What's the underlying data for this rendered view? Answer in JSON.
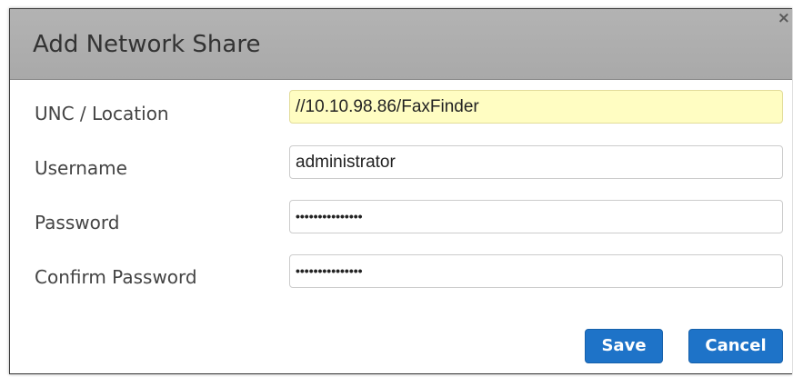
{
  "dialog": {
    "title": "Add Network Share",
    "close_label": "×"
  },
  "form": {
    "unc": {
      "label": "UNC / Location",
      "value": "//10.10.98.86/FaxFinder"
    },
    "username": {
      "label": "Username",
      "value": "administrator"
    },
    "password": {
      "label": "Password",
      "value": "•••••••••••••••"
    },
    "confirm_password": {
      "label": "Confirm Password",
      "value": "•••••••••••••••"
    }
  },
  "buttons": {
    "save_label": "Save",
    "cancel_label": "Cancel"
  },
  "colors": {
    "header_bg": "#acacac",
    "highlight_field_bg": "#fffdc2",
    "button_bg": "#1e73c8"
  }
}
